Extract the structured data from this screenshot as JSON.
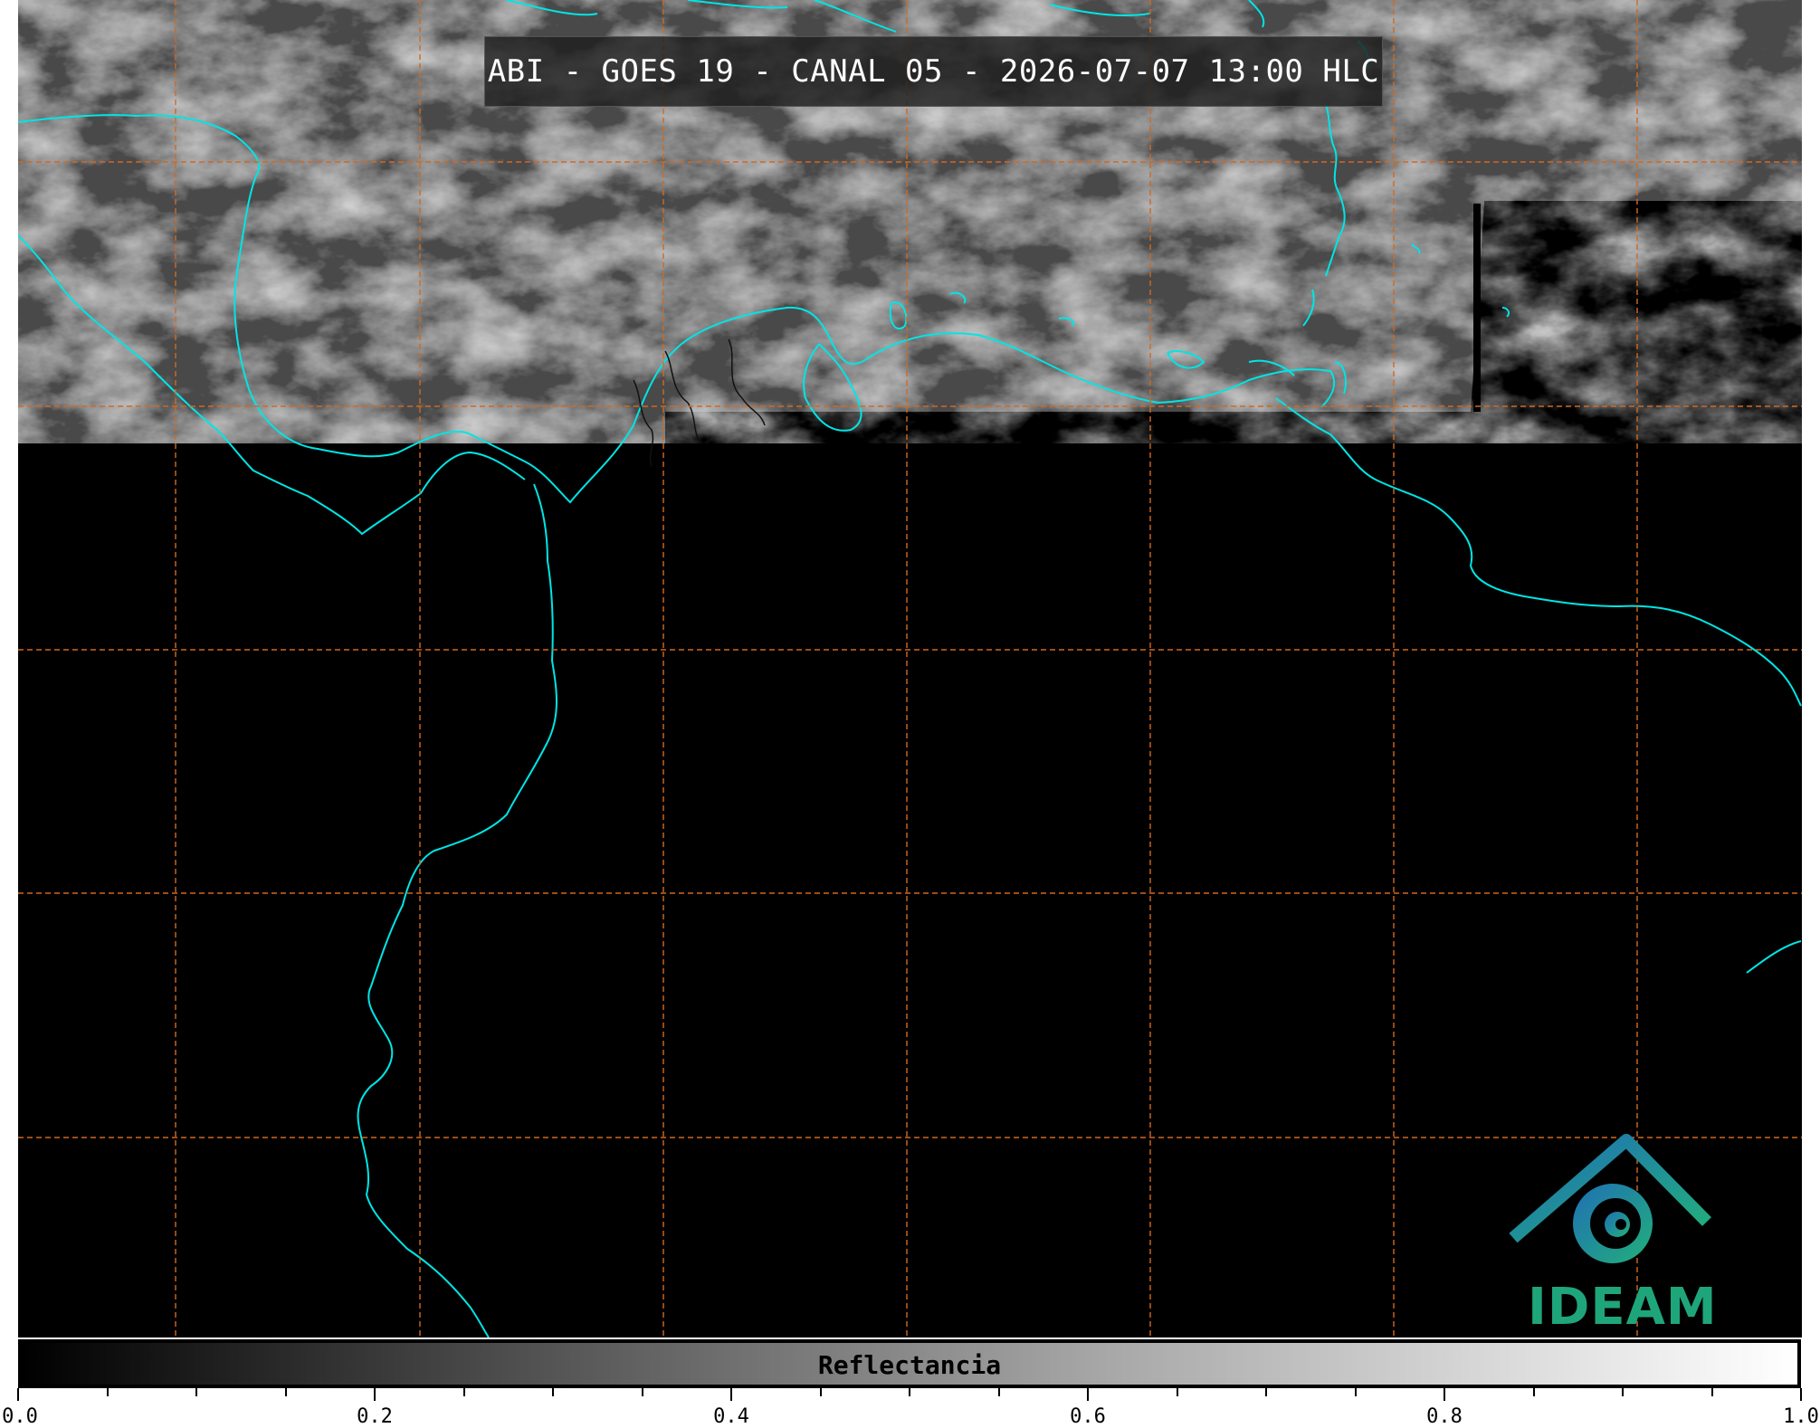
{
  "title": "ABI - GOES 19 - CANAL 05 - 2026-07-07 13:00 HLC",
  "colorbar": {
    "label": "Reflectancia",
    "ticks": [
      "0.0",
      "0.2",
      "0.4",
      "0.6",
      "0.8",
      "1.0"
    ],
    "range": [
      0.0,
      1.0
    ]
  },
  "logo": {
    "text": "IDEAM"
  },
  "colors": {
    "coastline": "#00e5e5",
    "gridline": "#d2691e",
    "background": "#000000",
    "logo_green": "#1fa57a",
    "logo_blue": "#1f7fb5"
  }
}
